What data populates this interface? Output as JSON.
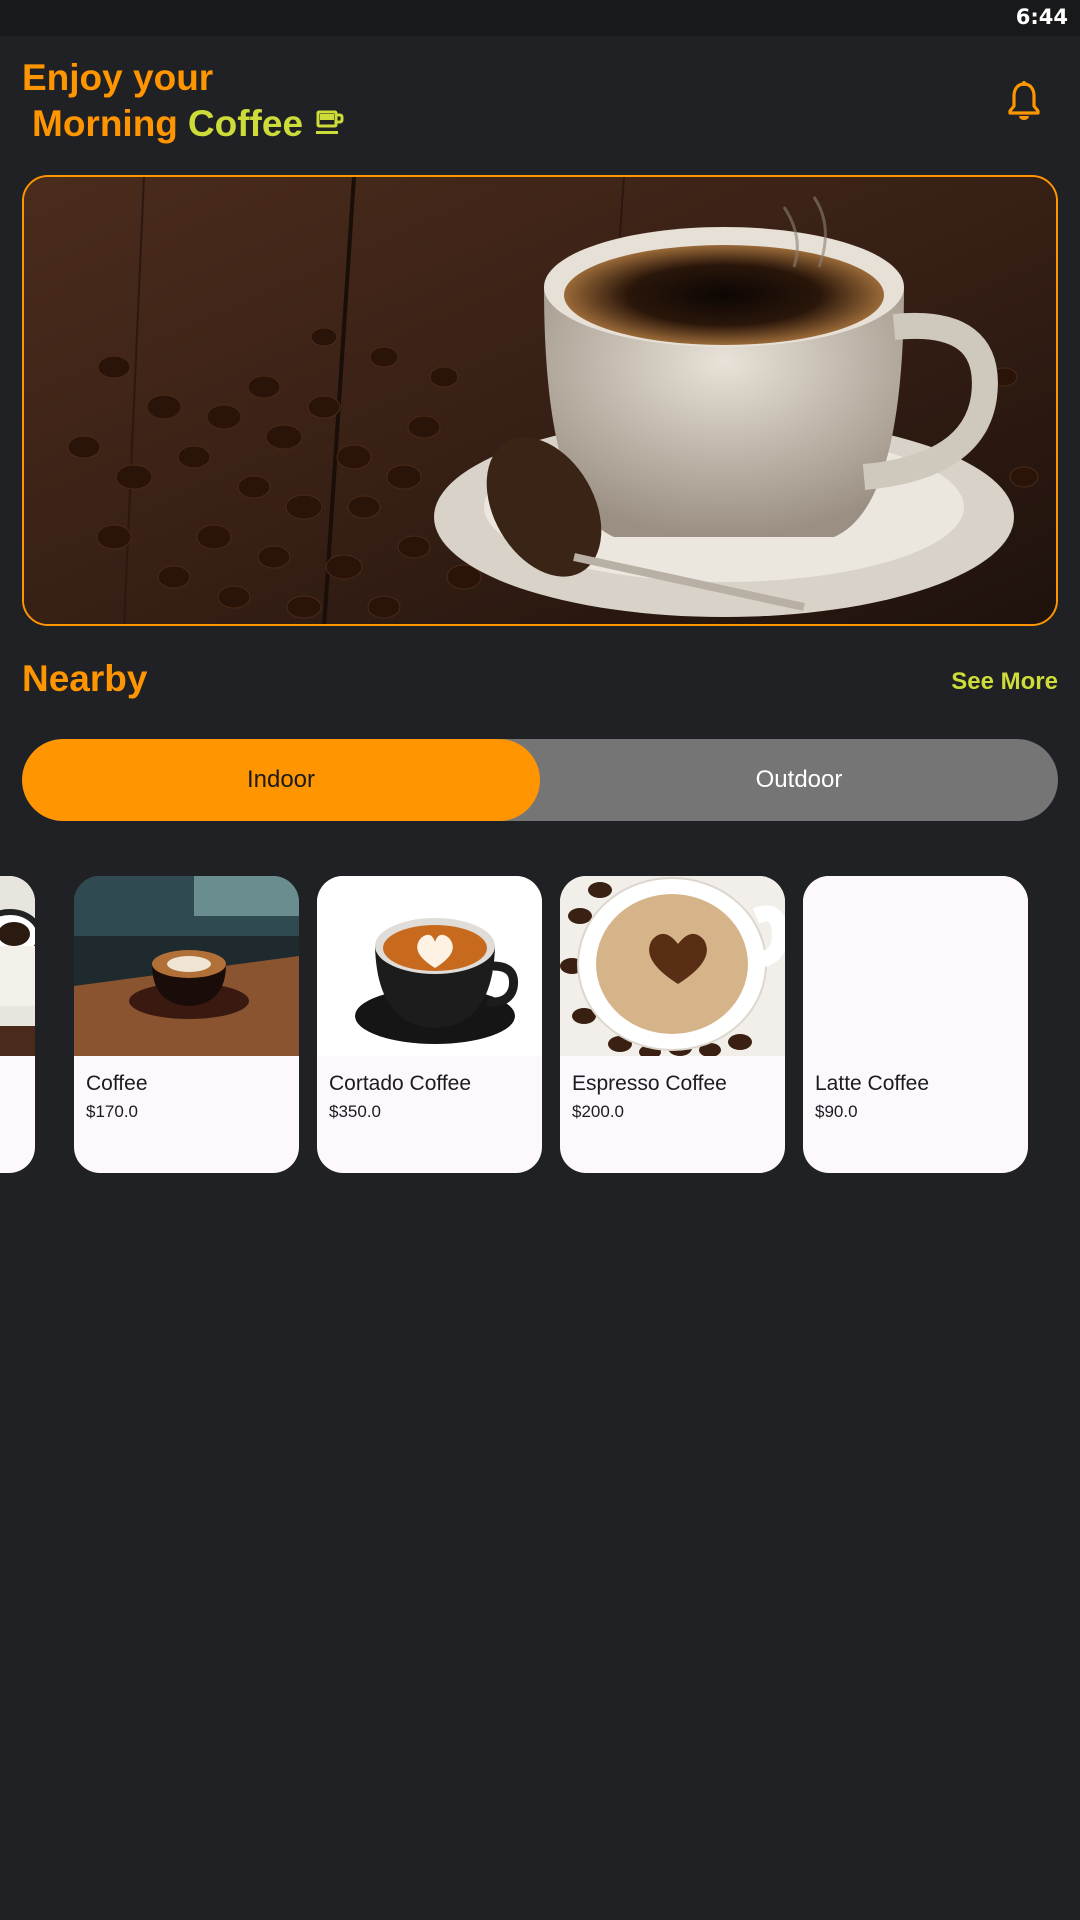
{
  "status_bar": {
    "time": "6:44"
  },
  "header": {
    "greeting_line1": "Enjoy your",
    "greeting_morning": "Morning",
    "greeting_coffee": "Coffee",
    "cup_icon": "coffee-cup-icon",
    "bell_icon": "bell-icon"
  },
  "colors": {
    "accent_orange": "#ff9500",
    "accent_lime": "#cddc39",
    "background": "#202124",
    "toggle_inactive": "#757575",
    "card_bg": "#fdf7fe"
  },
  "nearby": {
    "title": "Nearby",
    "see_more": "See More"
  },
  "toggle": {
    "tabs": [
      {
        "label": "Indoor",
        "active": true
      },
      {
        "label": "Outdoor",
        "active": false
      }
    ]
  },
  "products": [
    {
      "name": "Coffee",
      "price": "$170.0"
    },
    {
      "name": "Cortado Coffee",
      "price": "$350.0"
    },
    {
      "name": "Espresso Coffee",
      "price": "$200.0"
    },
    {
      "name": "Latte Coffee",
      "price": "$90.0"
    }
  ]
}
